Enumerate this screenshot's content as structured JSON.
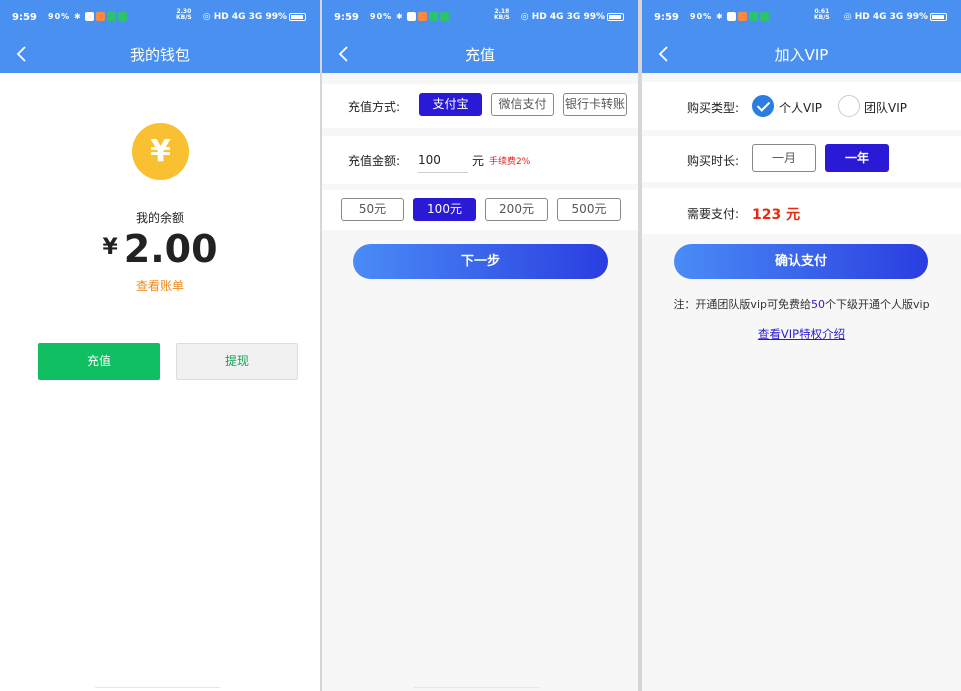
{
  "status": {
    "time": "9:59",
    "signal": "90%",
    "speed1": [
      "2.30",
      "KB/S"
    ],
    "speed2": [
      "2.18",
      "KB/S"
    ],
    "speed3": [
      "0.61",
      "KB/S"
    ],
    "net": "HD 4G 3G",
    "battery": "99%"
  },
  "wallet": {
    "title": "我的钱包",
    "coin_symbol": "¥",
    "balance_label": "我的余额",
    "currency": "¥",
    "balance": "2.00",
    "bill_link": "查看账单",
    "recharge_btn": "充值",
    "withdraw_btn": "提现"
  },
  "recharge": {
    "title": "充值",
    "method_label": "充值方式:",
    "methods": [
      "支付宝",
      "微信支付",
      "银行卡转账"
    ],
    "amount_label": "充值金额:",
    "amount_value": "100",
    "unit": "元",
    "fee": "手续费2%",
    "presets": [
      "50元",
      "100元",
      "200元",
      "500元"
    ],
    "next_btn": "下一步"
  },
  "vip": {
    "title": "加入VIP",
    "type_label": "购买类型:",
    "types": [
      "个人VIP",
      "团队VIP"
    ],
    "duration_label": "购买时长:",
    "durations": [
      "一月",
      "一年"
    ],
    "pay_label": "需要支付:",
    "price": "123 元",
    "confirm_btn": "确认支付",
    "note_prefix": "注：开通团队版vip可免费给",
    "note_count": "50",
    "note_suffix": "个下级开通个人版vip",
    "privilege_link": "查看VIP特权介绍"
  },
  "colors": {
    "header_blue": "#4a90f0",
    "active_chip": "#2a1ad6",
    "green": "#0fbf61",
    "coin": "#f9c131",
    "orange_link": "#f08a1c",
    "red_price": "#e02c10"
  }
}
